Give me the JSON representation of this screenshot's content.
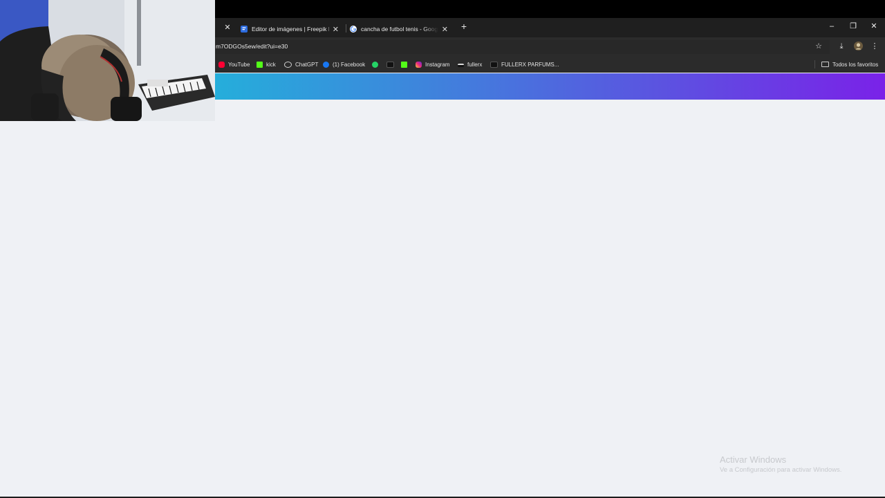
{
  "tabs": [
    {
      "title": "Editor de imágenes | Freepik IA",
      "icon": "freepik-icon",
      "close": "✕"
    },
    {
      "title": "cancha de futbol tenis - Google",
      "icon": "google-icon",
      "close": "✕"
    }
  ],
  "left_tab_close": "✕",
  "new_tab": "+",
  "window_controls": {
    "minimize": "–",
    "restore": "❐",
    "close": "✕"
  },
  "address_bar": {
    "url": "m7ODGOs5ew/edit?ui=e30"
  },
  "toolbar_icons": {
    "star": "☆",
    "download": "⤓",
    "menu": "⋮"
  },
  "bookmarks": [
    {
      "label": "YouTube",
      "icon": "youtube-icon",
      "color": "#ff0033"
    },
    {
      "label": "kick",
      "icon": "kick-icon",
      "color": "#53fc18"
    },
    {
      "label": "ChatGPT",
      "icon": "chatgpt-icon",
      "color": "#d0d0d0"
    },
    {
      "label": "(1) Facebook",
      "icon": "facebook-icon",
      "color": "#1877f2"
    },
    {
      "label": "",
      "icon": "whatsapp-icon",
      "color": "#25d366"
    },
    {
      "label": "",
      "icon": "tiktok-icon",
      "color": "#111111"
    },
    {
      "label": "",
      "icon": "kick-icon",
      "color": "#53fc18"
    },
    {
      "label": "Instagram",
      "icon": "instagram-icon",
      "color": "#e1306c"
    },
    {
      "label": "fullerx",
      "icon": "fullerx-icon",
      "color": "#111111"
    },
    {
      "label": "FULLERX PARFUMS...",
      "icon": "tiktok-icon",
      "color": "#111111"
    }
  ],
  "all_bookmarks": {
    "label": "Todos los favoritos",
    "icon": "folder-icon"
  },
  "banner": {
    "gradient_from": "#25aedb",
    "gradient_to": "#7a22e8"
  },
  "watermark": {
    "title": "Activar Windows",
    "subtitle": "Ve a Configuración para activar Windows."
  }
}
